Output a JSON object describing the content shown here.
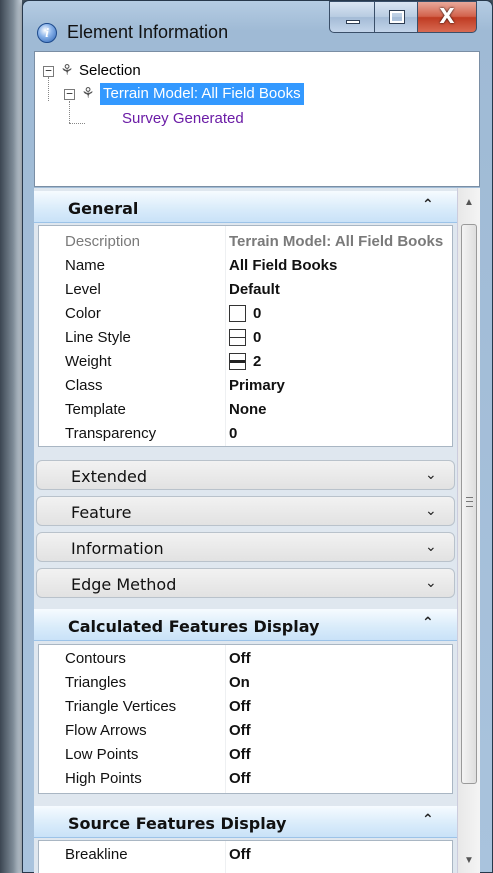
{
  "window": {
    "title": "Element Information",
    "icon": "info-icon",
    "close_glyph": "X"
  },
  "tree": {
    "root": {
      "label": "Selection",
      "expander": "−"
    },
    "child": {
      "label": "Terrain Model: All Field Books",
      "expander": "−"
    },
    "leaf": {
      "label": "Survey Generated"
    }
  },
  "sections": {
    "general": {
      "label": "General",
      "rows": [
        {
          "name": "Description",
          "value": "Terrain Model: All Field Books"
        },
        {
          "name": "Name",
          "value": "All Field Books"
        },
        {
          "name": "Level",
          "value": "Default"
        },
        {
          "name": "Color",
          "value": "0"
        },
        {
          "name": "Line Style",
          "value": "0"
        },
        {
          "name": "Weight",
          "value": "2"
        },
        {
          "name": "Class",
          "value": "Primary"
        },
        {
          "name": "Template",
          "value": "None"
        },
        {
          "name": "Transparency",
          "value": "0"
        }
      ]
    },
    "extended": {
      "label": "Extended"
    },
    "feature": {
      "label": "Feature"
    },
    "information": {
      "label": "Information"
    },
    "edge_method": {
      "label": "Edge Method"
    },
    "calculated": {
      "label": "Calculated Features Display",
      "rows": [
        {
          "name": "Contours",
          "value": "Off"
        },
        {
          "name": "Triangles",
          "value": "On"
        },
        {
          "name": "Triangle Vertices",
          "value": "Off"
        },
        {
          "name": "Flow Arrows",
          "value": "Off"
        },
        {
          "name": "Low Points",
          "value": "Off"
        },
        {
          "name": "High Points",
          "value": "Off"
        }
      ]
    },
    "source": {
      "label": "Source Features Display",
      "rows": [
        {
          "name": "Breakline",
          "value": "Off"
        }
      ]
    }
  },
  "glyphs": {
    "collapse": "⌃",
    "expand": "⌄",
    "scroll_up": "▲",
    "scroll_down": "▼"
  },
  "colors": {
    "selection": "#3399ff",
    "leaf_text": "#6b1ca6",
    "close_button": "#c9432a"
  }
}
